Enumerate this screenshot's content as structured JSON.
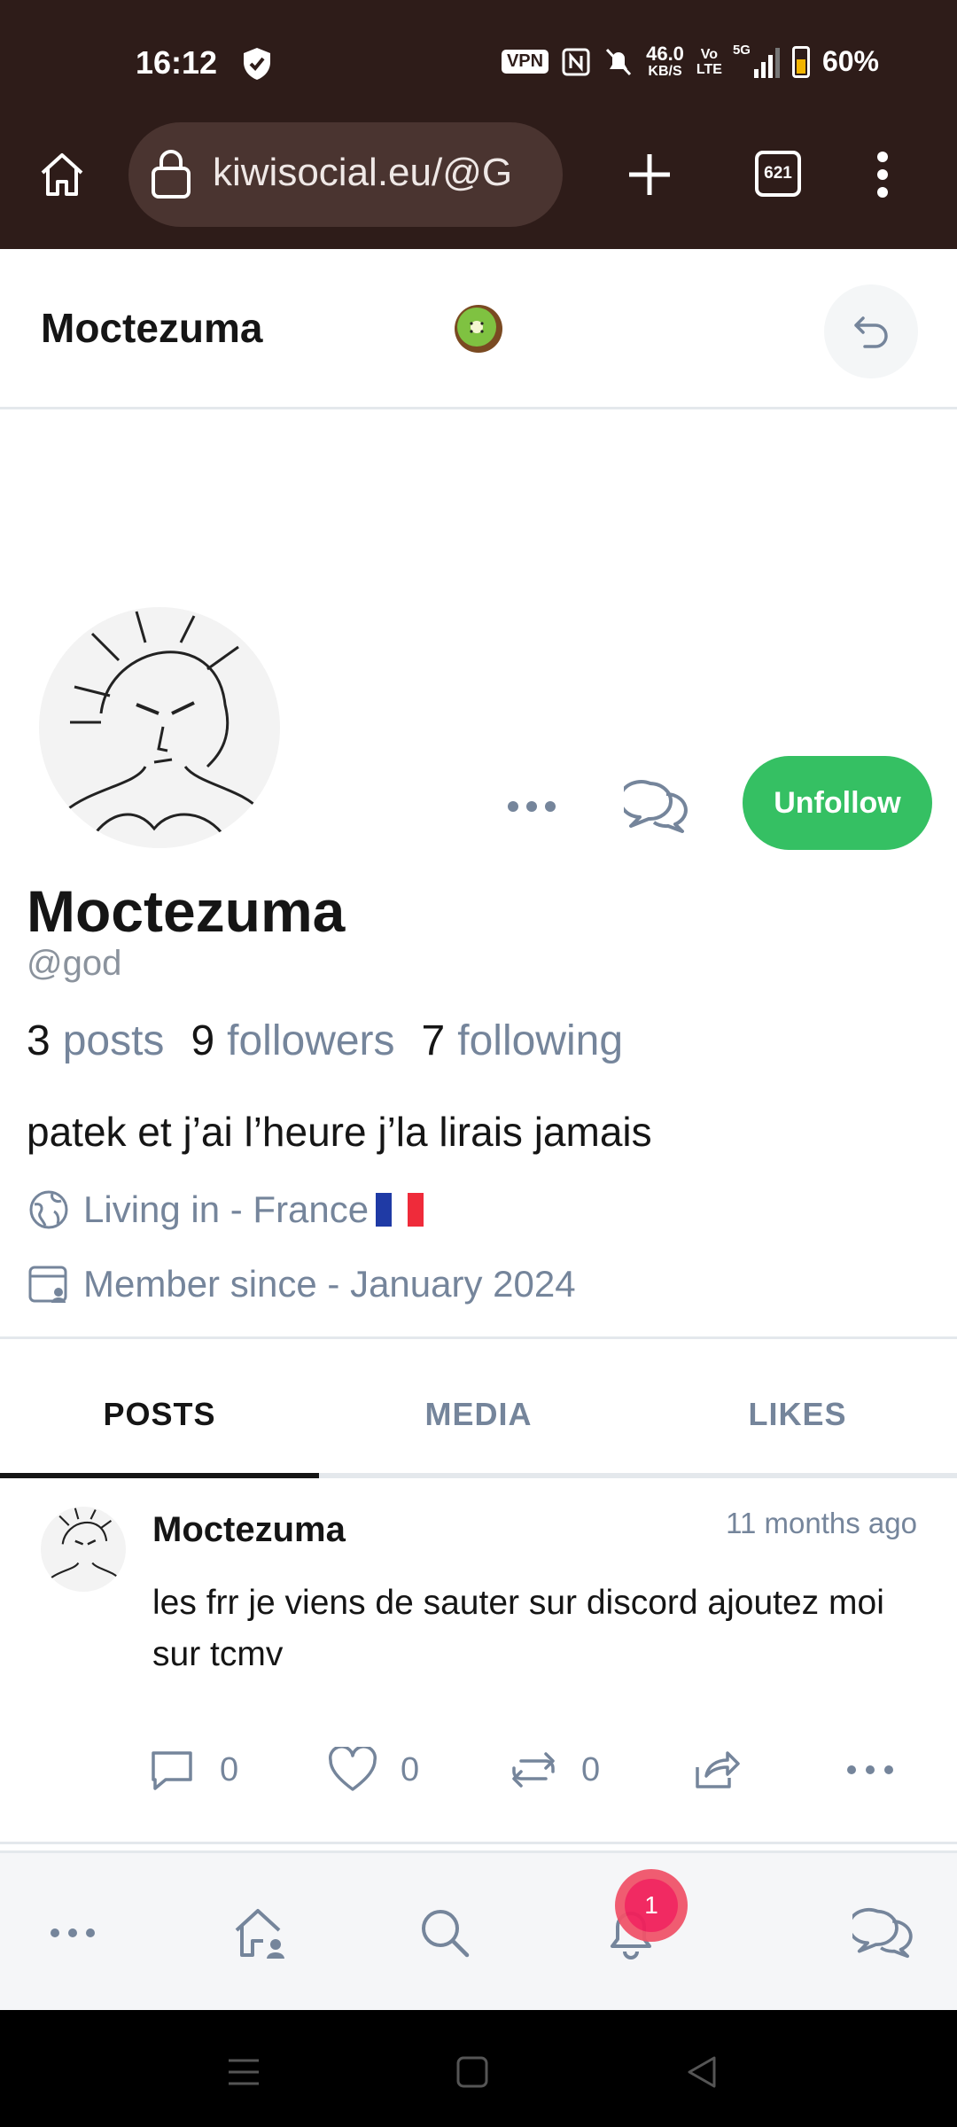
{
  "status_bar": {
    "time": "16:12",
    "vpn": "VPN",
    "net_speed_top": "46.0",
    "net_speed_bottom": "KB/S",
    "volte_top": "Vo",
    "volte_bottom": "LTE",
    "network": "5G",
    "battery": "60%"
  },
  "browser": {
    "url": "kiwisocial.eu/@G",
    "tab_count": "621"
  },
  "header": {
    "title": "Moctezuma"
  },
  "profile": {
    "display_name": "Moctezuma",
    "handle": "@god",
    "posts_count": "3",
    "posts_label": "posts",
    "followers_count": "9",
    "followers_label": "followers",
    "following_count": "7",
    "following_label": "following",
    "bio": "patek et j’ai l’heure j’la lirais jamais",
    "location": "Living in - France",
    "member_since": "Member since - January 2024",
    "unfollow_label": "Unfollow"
  },
  "tabs": [
    {
      "label": "POSTS",
      "active": true
    },
    {
      "label": "MEDIA",
      "active": false
    },
    {
      "label": "LIKES",
      "active": false
    }
  ],
  "post": {
    "author": "Moctezuma",
    "time": "11 months ago",
    "text": "les frr je viens de sauter sur discord ajoutez moi sur tcmv",
    "comments": "0",
    "likes": "0",
    "reposts": "0"
  },
  "bottom_nav": {
    "notifications_badge": "1"
  },
  "colors": {
    "browser_chrome": "#2e1c19",
    "accent_green": "#35c063",
    "muted_text": "#75859b",
    "badge": "#f1205b"
  },
  "icons": [
    "home-icon",
    "lock-icon",
    "plus-icon",
    "tabs-icon",
    "kebab-menu-icon",
    "kiwi-icon",
    "undo-arrow-icon",
    "more-horizontal-icon",
    "chat-bubbles-icon",
    "globe-icon",
    "calendar-user-icon",
    "comment-icon",
    "heart-icon",
    "repost-icon",
    "share-icon",
    "home-user-icon",
    "search-icon",
    "bell-icon"
  ]
}
